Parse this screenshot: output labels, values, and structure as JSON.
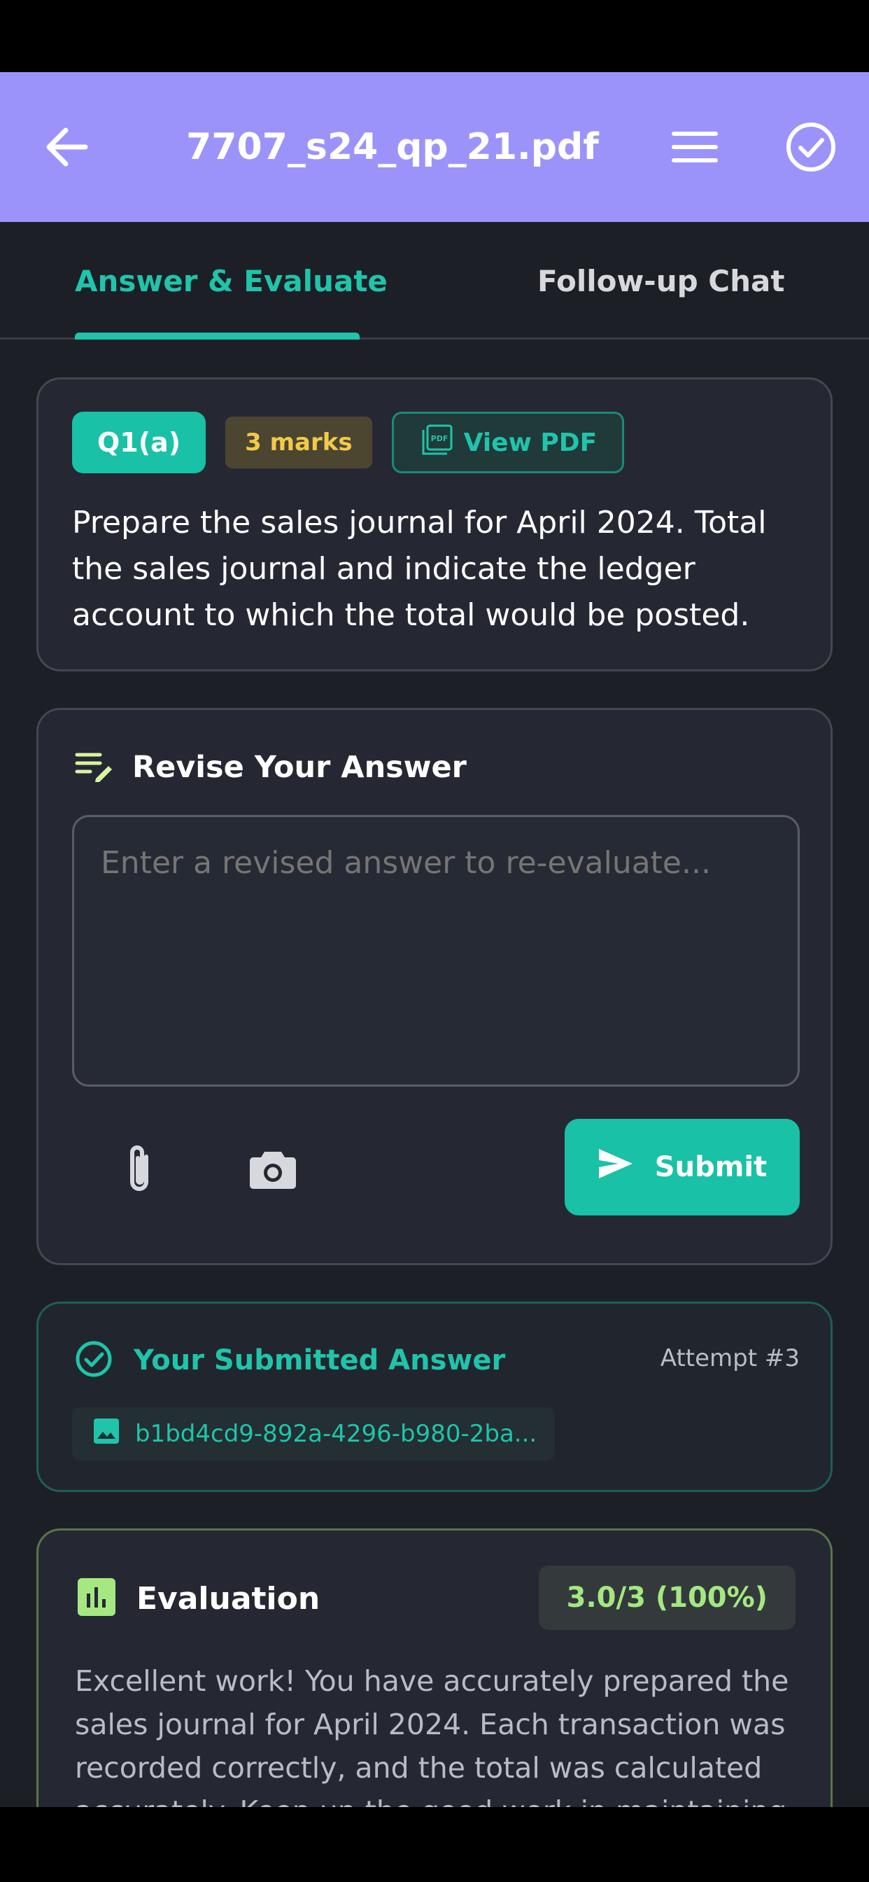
{
  "app_bar": {
    "title": "7707_s24_qp_21.pdf",
    "background_color": "#9c93fa",
    "icons": [
      "back-arrow-icon",
      "menu-icon",
      "check-circle-icon"
    ]
  },
  "tabs": [
    {
      "label": "Answer & Evaluate",
      "active": true
    },
    {
      "label": "Follow-up Chat",
      "active": false
    }
  ],
  "question": {
    "number": "Q1(a)",
    "marks": "3 marks",
    "view_pdf_label": "View PDF",
    "text": "Prepare the sales journal for April 2024. Total the sales journal and indicate the ledger account to which the total would be posted."
  },
  "revise": {
    "title": "Revise Your Answer",
    "input_placeholder": "Enter a revised answer to re-evaluate...",
    "input_value": "",
    "submit_label": "Submit"
  },
  "submitted": {
    "title": "Your Submitted Answer",
    "attempt": "Attempt #3",
    "file_name": "b1bd4cd9-892a-4296-b980-2ba..."
  },
  "evaluation": {
    "title": "Evaluation",
    "score": "3.0/3 (100%)",
    "text": "Excellent work! You have accurately prepared the sales journal for April 2024. Each transaction was recorded correctly, and the total was calculated accurately. Keep up the good work in maintaining"
  },
  "colors": {
    "accent": "#19c1a6",
    "background": "#1d1f27",
    "card": "#252833",
    "marks": "#f2c94c",
    "score": "#a5e882"
  }
}
